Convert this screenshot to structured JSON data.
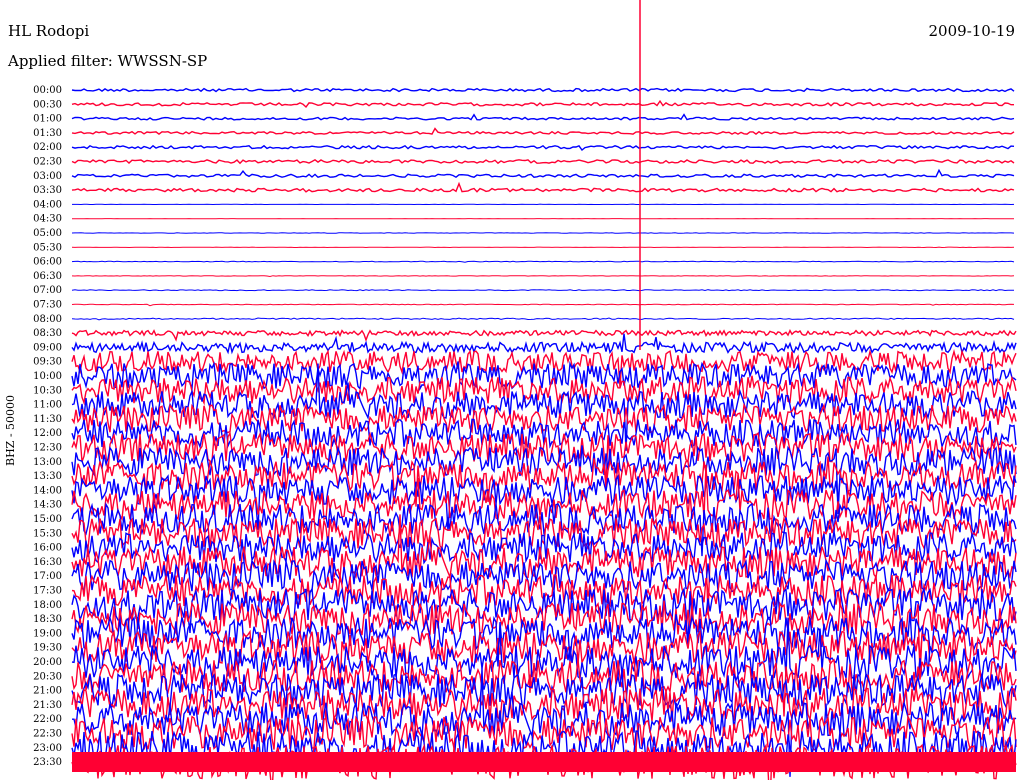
{
  "header": {
    "station": "HL Rodopi",
    "date": "2009-10-19",
    "filter": "Applied filter: WWSSN-SP"
  },
  "y_axis_label": "BHZ - 50000",
  "colors": {
    "trace_a": "#0000ff",
    "trace_b": "#ff0033",
    "text": "#000000",
    "background": "#ffffff"
  },
  "chart_data": {
    "type": "line",
    "title": "HL Rodopi",
    "subtitle": "Applied filter: WWSSN-SP",
    "ylabel": "BHZ - 50000",
    "rows": [
      "00:00",
      "00:30",
      "01:00",
      "01:30",
      "02:00",
      "02:30",
      "03:00",
      "03:30",
      "04:00",
      "04:30",
      "05:00",
      "05:30",
      "06:00",
      "06:30",
      "07:00",
      "07:30",
      "08:00",
      "08:30",
      "09:00",
      "09:30",
      "10:00",
      "10:30",
      "11:00",
      "11:30",
      "12:00",
      "12:30",
      "13:00",
      "13:30",
      "14:00",
      "14:30",
      "15:00",
      "15:30",
      "16:00",
      "16:30",
      "17:00",
      "17:30",
      "18:00",
      "18:30",
      "19:00",
      "19:30",
      "20:00",
      "20:30",
      "21:00",
      "21:30",
      "22:00",
      "22:30",
      "23:00",
      "23:30"
    ],
    "series_colors": [
      "#0000ff",
      "#ff0033"
    ],
    "noise_level": [
      0.35,
      0.35,
      0.3,
      0.3,
      0.35,
      0.4,
      0.35,
      0.4,
      0.02,
      0.02,
      0.05,
      0.04,
      0.08,
      0.05,
      0.1,
      0.08,
      0.15,
      0.6,
      1.2,
      2.5,
      3.0,
      3.2,
      3.2,
      3.3,
      3.3,
      3.4,
      3.4,
      3.5,
      3.5,
      3.5,
      3.6,
      3.6,
      3.6,
      3.7,
      3.7,
      3.7,
      3.8,
      3.8,
      3.8,
      3.9,
      3.9,
      3.9,
      4.0,
      4.0,
      4.0,
      4.0,
      4.0,
      4.0
    ],
    "grid": false
  }
}
